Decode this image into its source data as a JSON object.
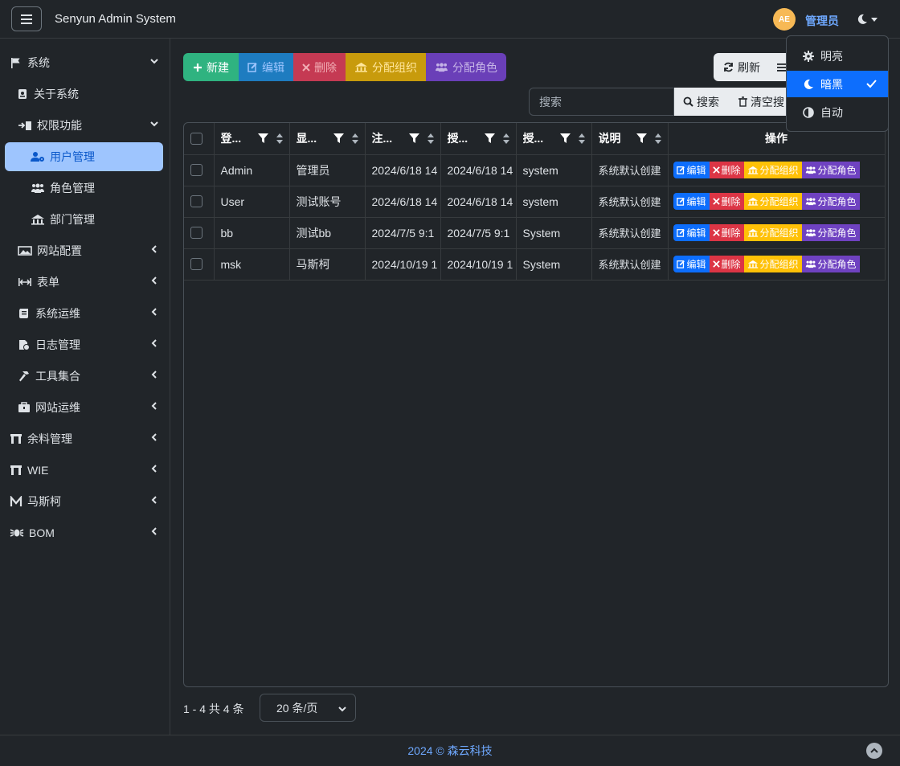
{
  "header": {
    "title": "Senyun Admin System",
    "avatar_text": "AE",
    "user_name": "管理员"
  },
  "theme_menu": {
    "items": [
      {
        "label": "明亮",
        "icon": "gear-icon"
      },
      {
        "label": "暗黑",
        "icon": "moon-icon",
        "active": true
      },
      {
        "label": "自动",
        "icon": "half-circle-icon"
      }
    ]
  },
  "sidebar": {
    "items": [
      {
        "label": "系统",
        "icon": "flag-icon",
        "chevron": "down"
      },
      {
        "label": "关于系统",
        "icon": "id-card-icon"
      },
      {
        "label": "权限功能",
        "icon": "permission-icon",
        "chevron": "down"
      },
      {
        "label": "用户管理",
        "icon": "user-gear-icon",
        "active": true
      },
      {
        "label": "角色管理",
        "icon": "users-icon"
      },
      {
        "label": "部门管理",
        "icon": "building-icon"
      },
      {
        "label": "网站配置",
        "icon": "image-icon",
        "chevron": "left"
      },
      {
        "label": "表单",
        "icon": "arrows-h-icon",
        "chevron": "left"
      },
      {
        "label": "系统运维",
        "icon": "scroll-icon",
        "chevron": "left"
      },
      {
        "label": "日志管理",
        "icon": "file-clock-icon",
        "chevron": "left"
      },
      {
        "label": "工具集合",
        "icon": "hammer-icon",
        "chevron": "left"
      },
      {
        "label": "网站运维",
        "icon": "toolbox-icon",
        "chevron": "left"
      },
      {
        "label": "余料管理",
        "icon": "torii-icon",
        "chevron": "left"
      },
      {
        "label": "WIE",
        "icon": "torii-icon",
        "chevron": "left"
      },
      {
        "label": "马斯柯",
        "icon": "letter-m-icon",
        "chevron": "left"
      },
      {
        "label": "BOM",
        "icon": "bug-icon",
        "chevron": "left"
      }
    ]
  },
  "toolbar": {
    "new": "新建",
    "edit": "编辑",
    "delete": "删除",
    "assign_org": "分配组织",
    "assign_role": "分配角色",
    "refresh": "刷新"
  },
  "search": {
    "placeholder": "搜索",
    "search_btn": "搜索",
    "clear_btn": "清空搜"
  },
  "table": {
    "columns": [
      "登...",
      "显...",
      "注...",
      "授...",
      "授...",
      "说明",
      "操作"
    ],
    "rows": [
      {
        "login": "Admin",
        "display": "管理员",
        "registered": "2024/6/18 14",
        "authorized": "2024/6/18 14",
        "auth_by": "system",
        "desc": "系统默认创建"
      },
      {
        "login": "User",
        "display": "测试账号",
        "registered": "2024/6/18 14",
        "authorized": "2024/6/18 14",
        "auth_by": "system",
        "desc": "系统默认创建"
      },
      {
        "login": "bb",
        "display": "测试bb",
        "registered": "2024/7/5 9:1",
        "authorized": "2024/7/5 9:1",
        "auth_by": "System",
        "desc": "系统默认创建"
      },
      {
        "login": "msk",
        "display": "马斯柯",
        "registered": "2024/10/19 1",
        "authorized": "2024/10/19 1",
        "auth_by": "System",
        "desc": "系统默认创建"
      }
    ],
    "row_actions": {
      "edit": "编辑",
      "delete": "删除",
      "assign_org": "分配组织",
      "assign_role": "分配角色"
    }
  },
  "pagination": {
    "info": "1 - 4 共 4 条",
    "page_size": "20 条/页"
  },
  "footer": {
    "text": "2024 © 森云科技"
  },
  "colors": {
    "bg": "#212529",
    "accent": "#0d6efd",
    "active_nav": "#9ec5fe",
    "success": "#2fb380",
    "danger": "#dc3545",
    "warning": "#ffc107",
    "purple": "#6f42c1"
  }
}
